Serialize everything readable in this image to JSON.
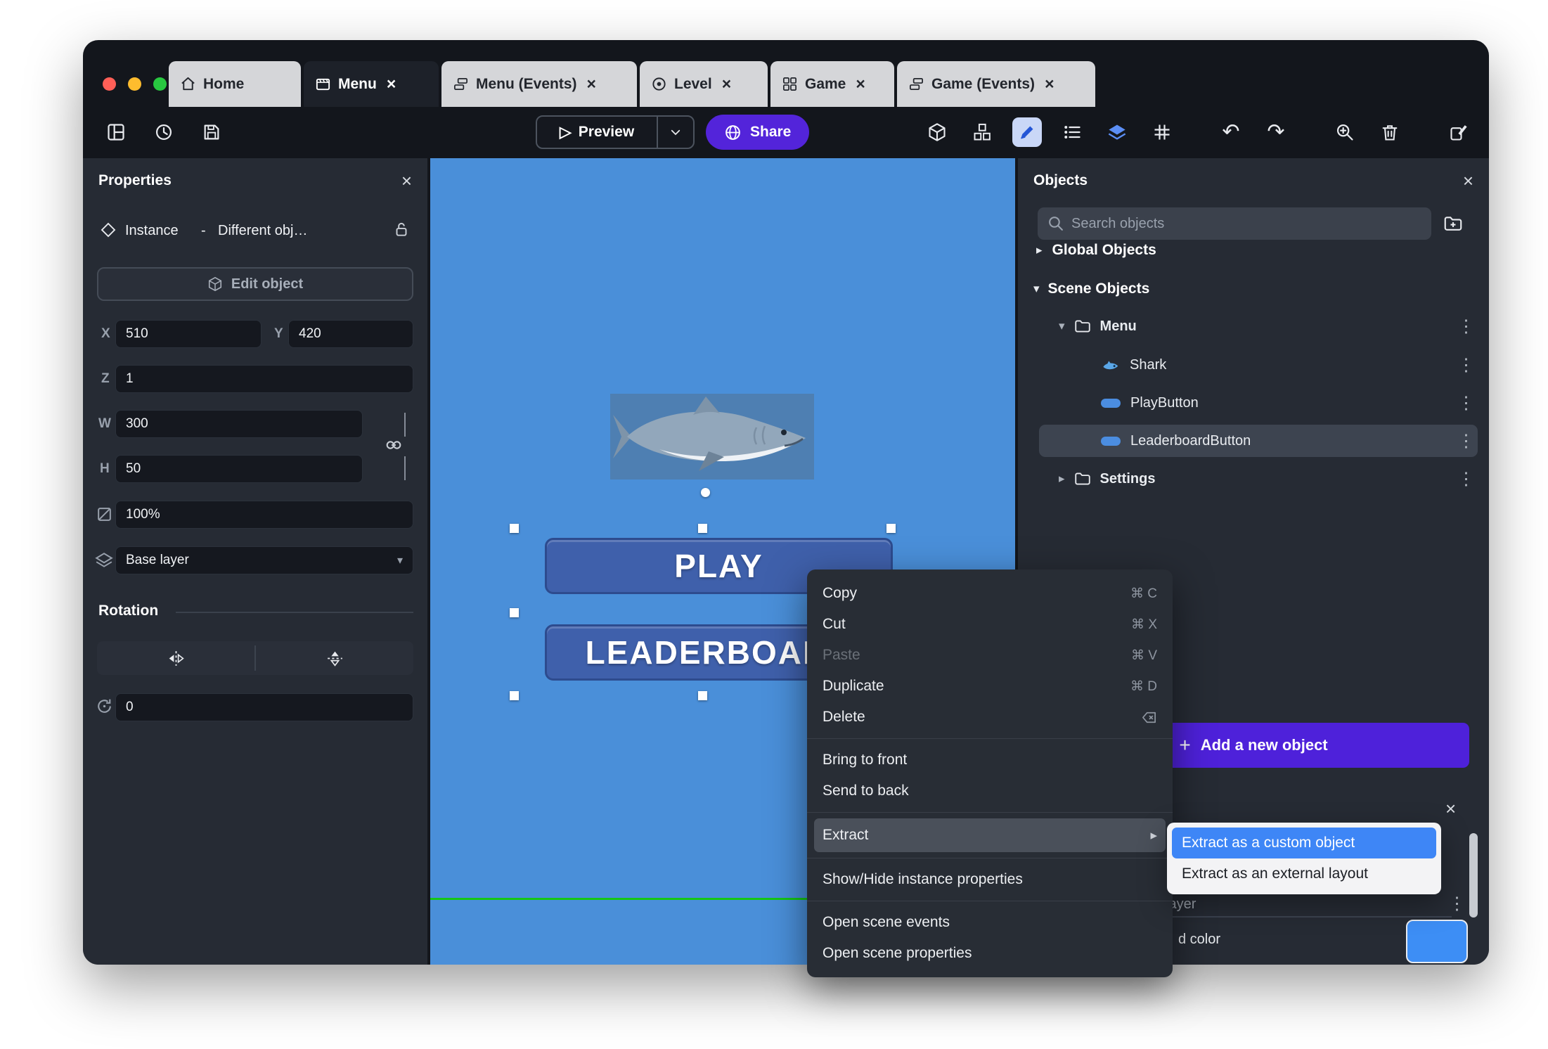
{
  "colors": {
    "canvas_blue": "#4a8fd9",
    "accent_purple_share": "#5324da",
    "accent_purple_add": "#4e21da",
    "submenu_selection_blue": "#3e86f6",
    "swatch_blue": "#3d8ef5",
    "traffic_red": "#ff5f57",
    "traffic_yellow": "#febc2e",
    "traffic_green": "#28c840"
  },
  "glyphs": {
    "close": "×",
    "kebab": "⋮",
    "tri_right": "▸",
    "tri_down": "▾",
    "chevron_down": "▾",
    "submenu_arrow": "▸",
    "undo": "↶",
    "redo": "↷",
    "play": "▷",
    "plus": "+"
  },
  "tabs": [
    {
      "label": "Home"
    },
    {
      "label": "Menu"
    },
    {
      "label": "Menu (Events)"
    },
    {
      "label": "Level"
    },
    {
      "label": "Game"
    },
    {
      "label": "Game (Events)"
    }
  ],
  "toolbar": {
    "preview_label": "Preview",
    "share_label": "Share"
  },
  "properties": {
    "title": "Properties",
    "instance_type": "Instance",
    "separator": "-",
    "instance_name": "Different obj…",
    "edit_object_label": "Edit object",
    "x_label": "X",
    "x_value": "510",
    "y_label": "Y",
    "y_value": "420",
    "z_label": "Z",
    "z_value": "1",
    "w_label": "W",
    "w_value": "300",
    "h_label": "H",
    "h_value": "50",
    "opacity_value": "100%",
    "layer_value": "Base layer",
    "rotation_title": "Rotation",
    "rotation_value": "0"
  },
  "canvas": {
    "play_label": "PLAY",
    "leaderboard_label": "LEADERBOARD"
  },
  "context_menu": {
    "items": [
      {
        "label": "Copy",
        "shortcut": "⌘ C"
      },
      {
        "label": "Cut",
        "shortcut": "⌘ X"
      },
      {
        "label": "Paste",
        "shortcut": "⌘ V",
        "disabled": true
      },
      {
        "label": "Duplicate",
        "shortcut": "⌘ D"
      },
      {
        "label": "Delete",
        "shortcut_icon": "backspace"
      },
      {
        "label": "Bring to front"
      },
      {
        "label": "Send to back"
      },
      {
        "label": "Extract",
        "has_submenu": true,
        "highlighted": true
      },
      {
        "label": "Show/Hide instance properties"
      },
      {
        "label": "Open scene events"
      },
      {
        "label": "Open scene properties"
      }
    ]
  },
  "submenu": {
    "items": [
      {
        "label": "Extract as a custom object",
        "highlighted": true
      },
      {
        "label": "Extract as an external layout"
      }
    ]
  },
  "objects": {
    "title": "Objects",
    "search_placeholder": "Search objects",
    "global_group": "Global Objects",
    "scene_group": "Scene Objects",
    "tree": [
      {
        "label": "Menu",
        "type": "folder",
        "expanded": true
      },
      {
        "label": "Shark",
        "type": "sprite"
      },
      {
        "label": "PlayButton",
        "type": "button"
      },
      {
        "label": "LeaderboardButton",
        "type": "button",
        "selected": true
      },
      {
        "label": "Settings",
        "type": "folder",
        "expanded": false
      }
    ],
    "add_button_label": "Add a new object",
    "bottom_panel": {
      "layer_fragment": "layer",
      "color_fragment": "d color",
      "swatch_color": "#3d8ef5"
    }
  }
}
